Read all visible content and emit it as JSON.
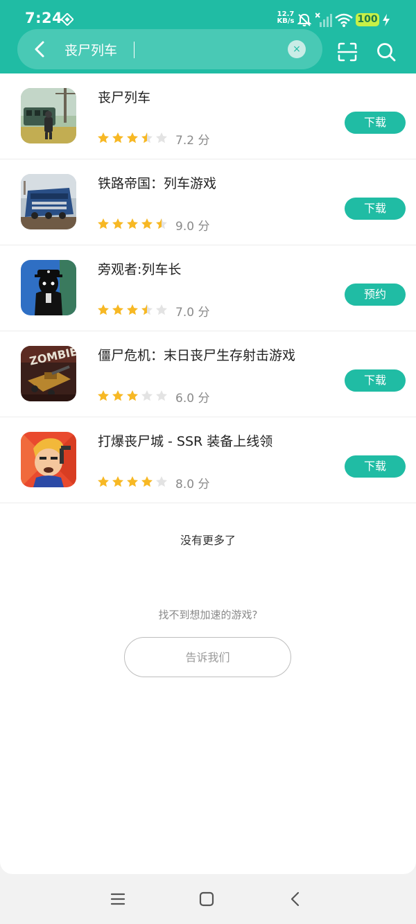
{
  "status_bar": {
    "time": "7:24",
    "net_speed_value": "12.7",
    "net_speed_unit": "KB/s",
    "battery": "100"
  },
  "search": {
    "query": "丧尸列车",
    "clear_symbol": "×"
  },
  "results": [
    {
      "title": "丧尸列车",
      "rating": 3.5,
      "score": "7.2 分",
      "action": "下载"
    },
    {
      "title": "铁路帝国：列车游戏",
      "rating": 4.5,
      "score": "9.0 分",
      "action": "下载"
    },
    {
      "title": "旁观者:列车长",
      "rating": 3.5,
      "score": "7.0 分",
      "action": "预约"
    },
    {
      "title": "僵尸危机：末日丧尸生存射击游戏",
      "rating": 3,
      "score": "6.0 分",
      "action": "下载"
    },
    {
      "title": "打爆丧尸城 - SSR 装备上线领",
      "rating": 4,
      "score": "8.0 分",
      "action": "下载"
    }
  ],
  "footer": {
    "no_more": "没有更多了",
    "cant_find": "找不到想加速的游戏?",
    "tell_us": "告诉我们"
  },
  "colors": {
    "accent": "#20bca4",
    "star_on": "#f7b824",
    "star_off": "#e3e3e3"
  }
}
